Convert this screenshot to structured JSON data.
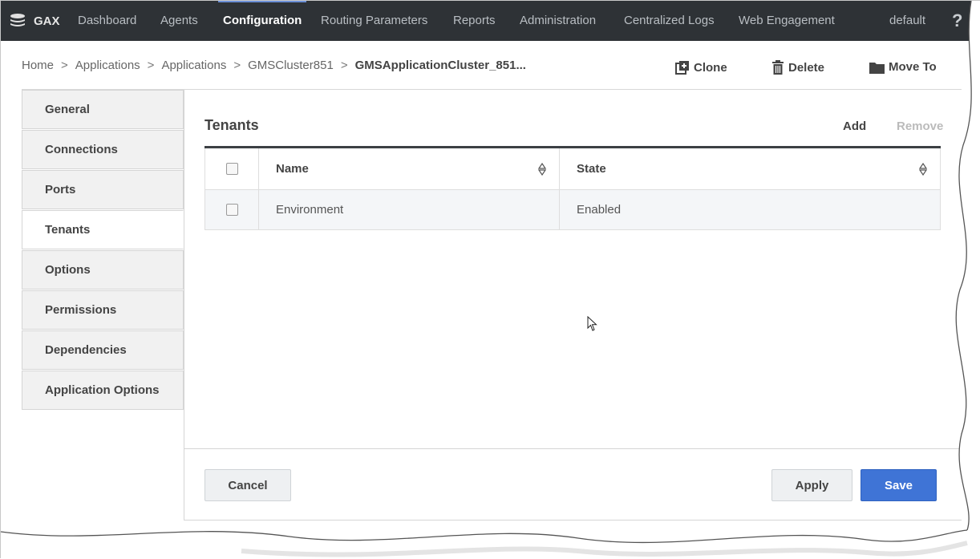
{
  "app": {
    "brand": "GAX"
  },
  "nav": {
    "items": [
      {
        "label": "Dashboard"
      },
      {
        "label": "Agents"
      },
      {
        "label": "Configuration"
      },
      {
        "label": "Routing Parameters"
      },
      {
        "label": "Reports"
      },
      {
        "label": "Administration"
      },
      {
        "label": "Centralized Logs"
      },
      {
        "label": "Web Engagement"
      }
    ],
    "active": "Configuration",
    "tenant": "default",
    "help": "?"
  },
  "breadcrumb": {
    "items": [
      "Home",
      "Applications",
      "Applications",
      "GMSCluster851"
    ],
    "current": "GMSApplicationCluster_851...",
    "separator": ">"
  },
  "actions": {
    "clone": "Clone",
    "delete": "Delete",
    "move_to": "Move To"
  },
  "sidebar": {
    "tabs": [
      {
        "label": "General"
      },
      {
        "label": "Connections"
      },
      {
        "label": "Ports"
      },
      {
        "label": "Tenants"
      },
      {
        "label": "Options"
      },
      {
        "label": "Permissions"
      },
      {
        "label": "Dependencies"
      },
      {
        "label": "Application Options"
      }
    ],
    "active": "Tenants"
  },
  "section": {
    "title": "Tenants",
    "add": "Add",
    "remove": "Remove"
  },
  "table": {
    "columns": [
      "Name",
      "State"
    ],
    "rows": [
      {
        "name": "Environment",
        "state": "Enabled"
      }
    ]
  },
  "buttons": {
    "cancel": "Cancel",
    "apply": "Apply",
    "save": "Save"
  },
  "colors": {
    "nav_bg": "#2e3236",
    "primary": "#3f74d6"
  }
}
